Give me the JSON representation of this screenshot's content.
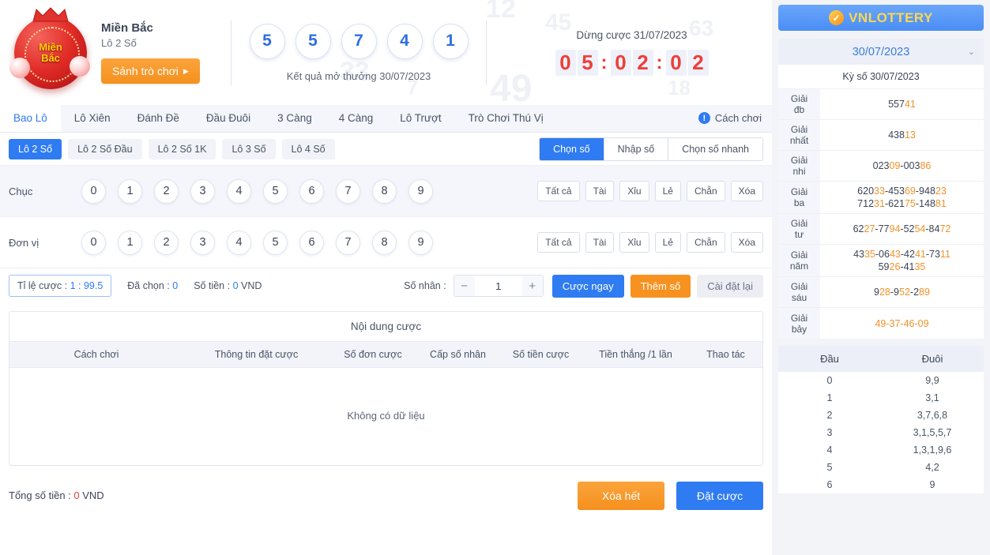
{
  "header": {
    "logo_text_line1": "Miền",
    "logo_text_line2": "Bắc",
    "region_title": "Miền Bắc",
    "game_subtitle": "Lô 2 Số",
    "lobby_button": "Sảnh trò chơi",
    "lobby_arrow": "▶",
    "result_numbers": [
      "5",
      "5",
      "7",
      "4",
      "1"
    ],
    "result_caption": "Kết quả mở thưởng 30/07/2023",
    "timer_label": "Dừng cược 31/07/2023",
    "timer_digits": [
      "0",
      "5",
      "0",
      "2",
      "0",
      "2"
    ],
    "timer_sep": ":",
    "watermarks": [
      "12",
      "49",
      "33",
      "45",
      "63",
      "18",
      "7"
    ]
  },
  "tabs": [
    {
      "label": "Bao Lô",
      "active": true
    },
    {
      "label": "Lô Xiên",
      "active": false
    },
    {
      "label": "Đánh Đề",
      "active": false
    },
    {
      "label": "Đầu Đuôi",
      "active": false
    },
    {
      "label": "3 Càng",
      "active": false
    },
    {
      "label": "4 Càng",
      "active": false
    },
    {
      "label": "Lô Trượt",
      "active": false
    },
    {
      "label": "Trò Chơi Thú Vị",
      "active": false
    }
  ],
  "help": {
    "label": "Cách chơi",
    "icon": "!"
  },
  "subtabs": [
    {
      "label": "Lô 2 Số",
      "active": true
    },
    {
      "label": "Lô 2 Số Đầu",
      "active": false
    },
    {
      "label": "Lô 2 Số 1K",
      "active": false
    },
    {
      "label": "Lô 3 Số",
      "active": false
    },
    {
      "label": "Lô 4 Số",
      "active": false
    }
  ],
  "segmented": [
    {
      "label": "Chọn số",
      "active": true
    },
    {
      "label": "Nhập số",
      "active": false
    },
    {
      "label": "Chọn số nhanh",
      "active": false
    }
  ],
  "number_rows": [
    {
      "label": "Chục",
      "digits": [
        "0",
        "1",
        "2",
        "3",
        "4",
        "5",
        "6",
        "7",
        "8",
        "9"
      ],
      "actions": [
        "Tất cả",
        "Tài",
        "Xỉu",
        "Lẻ",
        "Chẵn",
        "Xóa"
      ]
    },
    {
      "label": "Đơn vị",
      "digits": [
        "0",
        "1",
        "2",
        "3",
        "4",
        "5",
        "6",
        "7",
        "8",
        "9"
      ],
      "actions": [
        "Tất cả",
        "Tài",
        "Xỉu",
        "Lẻ",
        "Chẵn",
        "Xóa"
      ]
    }
  ],
  "betbar": {
    "ratio_prefix": "Tỉ lệ cược : ",
    "ratio_value": "1 : 99.5",
    "selected_prefix": "Đã chọn : ",
    "selected_value": "0",
    "amount_prefix": "Số tiền : ",
    "amount_value": "0",
    "amount_unit": " VND",
    "multiplier_label": "Số nhân :",
    "minus": "−",
    "multiplier_value": "1",
    "plus": "+",
    "bet_now": "Cược ngay",
    "add_number": "Thêm số",
    "reset": "Cài đặt lại"
  },
  "bet_table": {
    "title": "Nội dung cược",
    "columns": [
      "Cách chơi",
      "Thông tin đặt cược",
      "Số đơn cược",
      "Cấp số nhân",
      "Số tiền cược",
      "Tiền thắng /1 lần",
      "Thao tác"
    ],
    "empty_text": "Không có dữ liệu"
  },
  "footer": {
    "total_prefix": "Tổng số tiền : ",
    "total_value": "0",
    "total_unit": " VND",
    "clear_all": "Xóa hết",
    "place_bet": "Đặt cược"
  },
  "sidebar": {
    "brand": "VNLOTTERY",
    "brand_icon": "✓",
    "date": "30/07/2023",
    "chevron": "⌄",
    "period_label": "Kỳ số 30/07/2023",
    "prizes": [
      {
        "name_line1": "Giải",
        "name_line2": "đb",
        "plain": "557",
        "highlight": "41",
        "lines": [
          "55741"
        ]
      },
      {
        "name_line1": "Giải",
        "name_line2": "nhất",
        "plain": "438",
        "highlight": "13",
        "lines": [
          "43813"
        ]
      },
      {
        "name_line1": "Giải",
        "name_line2": "nhi",
        "lines": [
          "02309-00386"
        ]
      },
      {
        "name_line1": "Giải",
        "name_line2": "ba",
        "lines": [
          "62033-45369-94823",
          "71231-62175-14881"
        ]
      },
      {
        "name_line1": "Giải",
        "name_line2": "tư",
        "lines": [
          "6227-7794-5254-8472"
        ]
      },
      {
        "name_line1": "Giải",
        "name_line2": "năm",
        "lines": [
          "4335-0643-4241-7311",
          "5926-4135"
        ]
      },
      {
        "name_line1": "Giải",
        "name_line2": "sáu",
        "lines": [
          "928-952-289"
        ]
      },
      {
        "name_line1": "Giải",
        "name_line2": "bảy",
        "lines": [
          "49-37-46-09"
        ]
      }
    ],
    "dau_duoi": {
      "headers": [
        "Đầu",
        "Đuôi"
      ],
      "rows": [
        {
          "dau": "0",
          "duoi": "9,9"
        },
        {
          "dau": "1",
          "duoi": "3,1"
        },
        {
          "dau": "2",
          "duoi": "3,7,6,8"
        },
        {
          "dau": "3",
          "duoi": "3,1,5,5,7"
        },
        {
          "dau": "4",
          "duoi": "1,3,1,9,6"
        },
        {
          "dau": "5",
          "duoi": "4,2"
        },
        {
          "dau": "6",
          "duoi": "9"
        }
      ]
    }
  },
  "colors": {
    "accent_blue": "#2f7bf2",
    "accent_orange": "#f79220",
    "timer_red": "#ef3e36",
    "highlight_orange": "#f0922a"
  }
}
